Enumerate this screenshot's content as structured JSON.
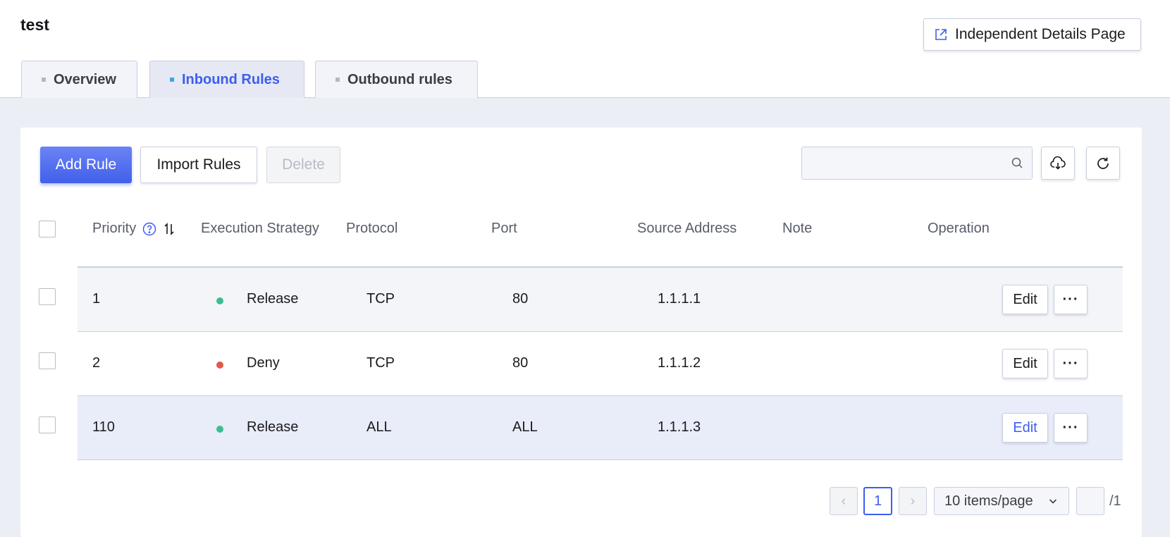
{
  "page_title": "test",
  "detail_button_label": "Independent Details Page",
  "tabs": [
    {
      "label": "Overview",
      "active": false
    },
    {
      "label": "Inbound Rules",
      "active": true
    },
    {
      "label": "Outbound rules",
      "active": false
    }
  ],
  "toolbar": {
    "add_label": "Add Rule",
    "import_label": "Import Rules",
    "delete_label": "Delete",
    "search_placeholder": "",
    "download_icon": "cloud-download-icon",
    "refresh_icon": "refresh-icon"
  },
  "table": {
    "columns": [
      "Priority",
      "Execution Strategy",
      "Protocol",
      "Port",
      "Source Address",
      "Note",
      "Operation"
    ],
    "rows": [
      {
        "priority": "1",
        "strategy": "Release",
        "strategy_color": "#3dbd8f",
        "protocol": "TCP",
        "port": "80",
        "source": "1.1.1.1",
        "note": ""
      },
      {
        "priority": "2",
        "strategy": "Deny",
        "strategy_color": "#e0594b",
        "protocol": "TCP",
        "port": "80",
        "source": "1.1.1.2",
        "note": ""
      },
      {
        "priority": "110",
        "strategy": "Release",
        "strategy_color": "#3dbd8f",
        "protocol": "ALL",
        "port": "ALL",
        "source": "1.1.1.3",
        "note": ""
      }
    ],
    "edit_label": "Edit",
    "more_label": "···"
  },
  "pagination": {
    "current_page": "1",
    "page_size_label": "10 items/page",
    "total_pages": "/1",
    "prev_glyph": "‹",
    "next_glyph": "›"
  },
  "colors": {
    "accent": "#3d5df0",
    "page_bg": "#eceef5",
    "border": "#c9cfe0"
  }
}
